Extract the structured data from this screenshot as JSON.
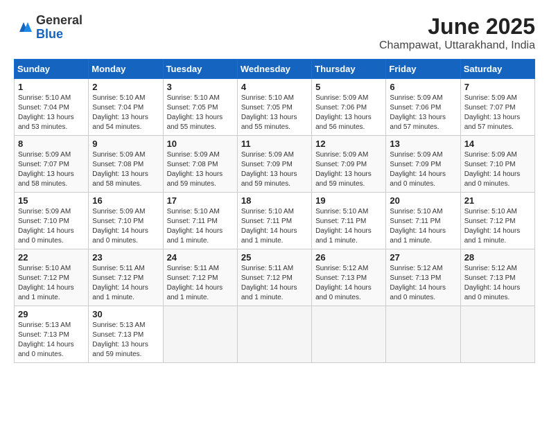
{
  "logo": {
    "general": "General",
    "blue": "Blue"
  },
  "header": {
    "month": "June 2025",
    "location": "Champawat, Uttarakhand, India"
  },
  "weekdays": [
    "Sunday",
    "Monday",
    "Tuesday",
    "Wednesday",
    "Thursday",
    "Friday",
    "Saturday"
  ],
  "weeks": [
    [
      {
        "day": "1",
        "sunrise": "5:10 AM",
        "sunset": "7:04 PM",
        "daylight": "13 hours and 53 minutes."
      },
      {
        "day": "2",
        "sunrise": "5:10 AM",
        "sunset": "7:04 PM",
        "daylight": "13 hours and 54 minutes."
      },
      {
        "day": "3",
        "sunrise": "5:10 AM",
        "sunset": "7:05 PM",
        "daylight": "13 hours and 55 minutes."
      },
      {
        "day": "4",
        "sunrise": "5:10 AM",
        "sunset": "7:05 PM",
        "daylight": "13 hours and 55 minutes."
      },
      {
        "day": "5",
        "sunrise": "5:09 AM",
        "sunset": "7:06 PM",
        "daylight": "13 hours and 56 minutes."
      },
      {
        "day": "6",
        "sunrise": "5:09 AM",
        "sunset": "7:06 PM",
        "daylight": "13 hours and 57 minutes."
      },
      {
        "day": "7",
        "sunrise": "5:09 AM",
        "sunset": "7:07 PM",
        "daylight": "13 hours and 57 minutes."
      }
    ],
    [
      {
        "day": "8",
        "sunrise": "5:09 AM",
        "sunset": "7:07 PM",
        "daylight": "13 hours and 58 minutes."
      },
      {
        "day": "9",
        "sunrise": "5:09 AM",
        "sunset": "7:08 PM",
        "daylight": "13 hours and 58 minutes."
      },
      {
        "day": "10",
        "sunrise": "5:09 AM",
        "sunset": "7:08 PM",
        "daylight": "13 hours and 59 minutes."
      },
      {
        "day": "11",
        "sunrise": "5:09 AM",
        "sunset": "7:09 PM",
        "daylight": "13 hours and 59 minutes."
      },
      {
        "day": "12",
        "sunrise": "5:09 AM",
        "sunset": "7:09 PM",
        "daylight": "13 hours and 59 minutes."
      },
      {
        "day": "13",
        "sunrise": "5:09 AM",
        "sunset": "7:09 PM",
        "daylight": "14 hours and 0 minutes."
      },
      {
        "day": "14",
        "sunrise": "5:09 AM",
        "sunset": "7:10 PM",
        "daylight": "14 hours and 0 minutes."
      }
    ],
    [
      {
        "day": "15",
        "sunrise": "5:09 AM",
        "sunset": "7:10 PM",
        "daylight": "14 hours and 0 minutes."
      },
      {
        "day": "16",
        "sunrise": "5:09 AM",
        "sunset": "7:10 PM",
        "daylight": "14 hours and 0 minutes."
      },
      {
        "day": "17",
        "sunrise": "5:10 AM",
        "sunset": "7:11 PM",
        "daylight": "14 hours and 1 minute."
      },
      {
        "day": "18",
        "sunrise": "5:10 AM",
        "sunset": "7:11 PM",
        "daylight": "14 hours and 1 minute."
      },
      {
        "day": "19",
        "sunrise": "5:10 AM",
        "sunset": "7:11 PM",
        "daylight": "14 hours and 1 minute."
      },
      {
        "day": "20",
        "sunrise": "5:10 AM",
        "sunset": "7:11 PM",
        "daylight": "14 hours and 1 minute."
      },
      {
        "day": "21",
        "sunrise": "5:10 AM",
        "sunset": "7:12 PM",
        "daylight": "14 hours and 1 minute."
      }
    ],
    [
      {
        "day": "22",
        "sunrise": "5:10 AM",
        "sunset": "7:12 PM",
        "daylight": "14 hours and 1 minute."
      },
      {
        "day": "23",
        "sunrise": "5:11 AM",
        "sunset": "7:12 PM",
        "daylight": "14 hours and 1 minute."
      },
      {
        "day": "24",
        "sunrise": "5:11 AM",
        "sunset": "7:12 PM",
        "daylight": "14 hours and 1 minute."
      },
      {
        "day": "25",
        "sunrise": "5:11 AM",
        "sunset": "7:12 PM",
        "daylight": "14 hours and 1 minute."
      },
      {
        "day": "26",
        "sunrise": "5:12 AM",
        "sunset": "7:13 PM",
        "daylight": "14 hours and 0 minutes."
      },
      {
        "day": "27",
        "sunrise": "5:12 AM",
        "sunset": "7:13 PM",
        "daylight": "14 hours and 0 minutes."
      },
      {
        "day": "28",
        "sunrise": "5:12 AM",
        "sunset": "7:13 PM",
        "daylight": "14 hours and 0 minutes."
      }
    ],
    [
      {
        "day": "29",
        "sunrise": "5:13 AM",
        "sunset": "7:13 PM",
        "daylight": "14 hours and 0 minutes."
      },
      {
        "day": "30",
        "sunrise": "5:13 AM",
        "sunset": "7:13 PM",
        "daylight": "13 hours and 59 minutes."
      },
      null,
      null,
      null,
      null,
      null
    ]
  ]
}
